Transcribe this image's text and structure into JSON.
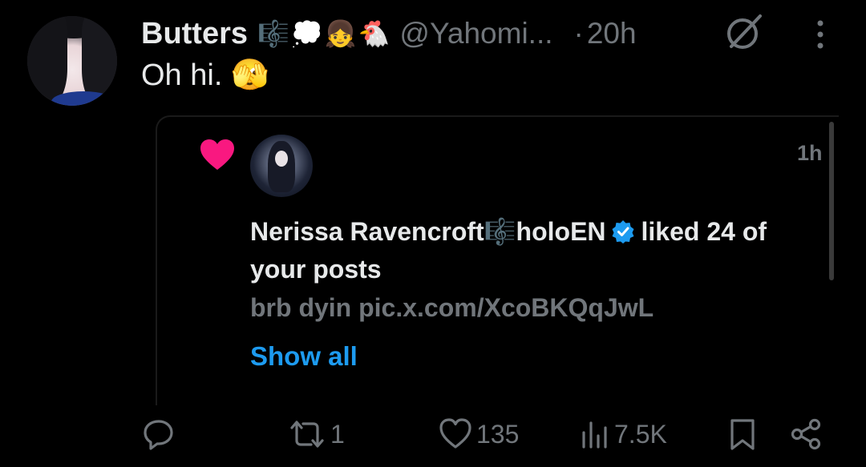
{
  "tweet": {
    "author_name": "Butters",
    "author_emojis": "🎼💭👧🐔",
    "handle": "@Yahomi...",
    "separator": "·",
    "time": "20h",
    "text": "Oh hi. 🫣"
  },
  "embed": {
    "time": "1h",
    "liker_name": "Nerissa Ravencroft🎼holoEN",
    "liked_text": "liked 24 of",
    "liked_text_cont": "your posts",
    "post_preview": "brb dyin pic.x.com/XcoBKQqJwL",
    "show_all": "Show all",
    "heart_color": "#f91880",
    "verified_color": "#1d9bf0"
  },
  "actions": {
    "reply": {
      "icon": "reply-icon",
      "count": ""
    },
    "repost": {
      "icon": "repost-icon",
      "count": "1"
    },
    "like": {
      "icon": "heart-icon",
      "count": "135"
    },
    "views": {
      "icon": "views-icon",
      "count": "7.5K"
    },
    "bookmark": {
      "icon": "bookmark-icon"
    },
    "share": {
      "icon": "share-icon"
    }
  },
  "icons": {
    "grok": "grok-icon",
    "more": "more-icon"
  },
  "colors": {
    "background": "#000000",
    "text": "#e7e9ea",
    "muted": "#71767b",
    "link": "#1d9bf0"
  }
}
